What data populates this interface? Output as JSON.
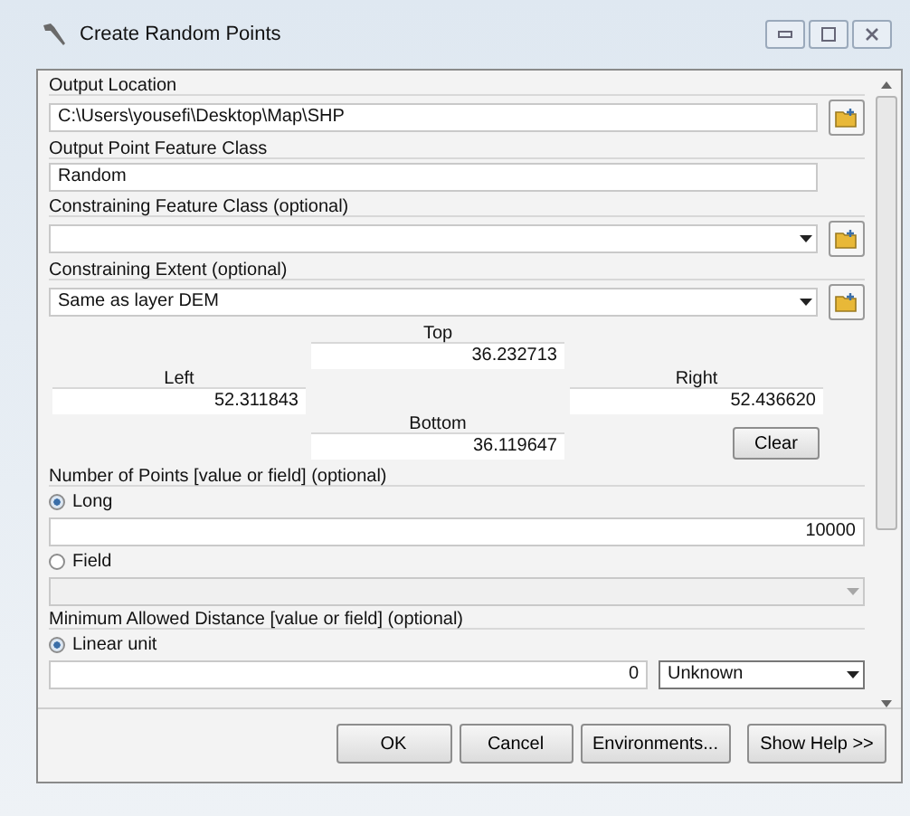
{
  "window": {
    "title": "Create Random Points"
  },
  "output_location": {
    "label": "Output Location",
    "value": "C:\\Users\\yousefi\\Desktop\\Map\\SHP"
  },
  "output_class": {
    "label": "Output Point Feature Class",
    "value": "Random"
  },
  "constraining_class": {
    "label": "Constraining Feature Class (optional)"
  },
  "extent": {
    "label": "Constraining Extent (optional)",
    "value": "Same as layer DEM",
    "top": {
      "label": "Top",
      "value": "36.232713"
    },
    "left": {
      "label": "Left",
      "value": "52.311843"
    },
    "right": {
      "label": "Right",
      "value": "52.436620"
    },
    "bottom": {
      "label": "Bottom",
      "value": "36.119647"
    },
    "clear_button": "Clear"
  },
  "number_of_points": {
    "label": "Number of Points [value or field] (optional)",
    "options": [
      {
        "label": "Long",
        "selected": true,
        "value": "10000"
      },
      {
        "label": "Field",
        "selected": false,
        "disabled": true
      }
    ]
  },
  "min_distance": {
    "label": "Minimum Allowed Distance [value or field] (optional)",
    "option": {
      "label": "Linear unit",
      "selected": true
    },
    "value": "0",
    "unit": "Unknown"
  },
  "buttons": [
    "OK",
    "Cancel",
    "Environments...",
    "Show Help >>"
  ]
}
